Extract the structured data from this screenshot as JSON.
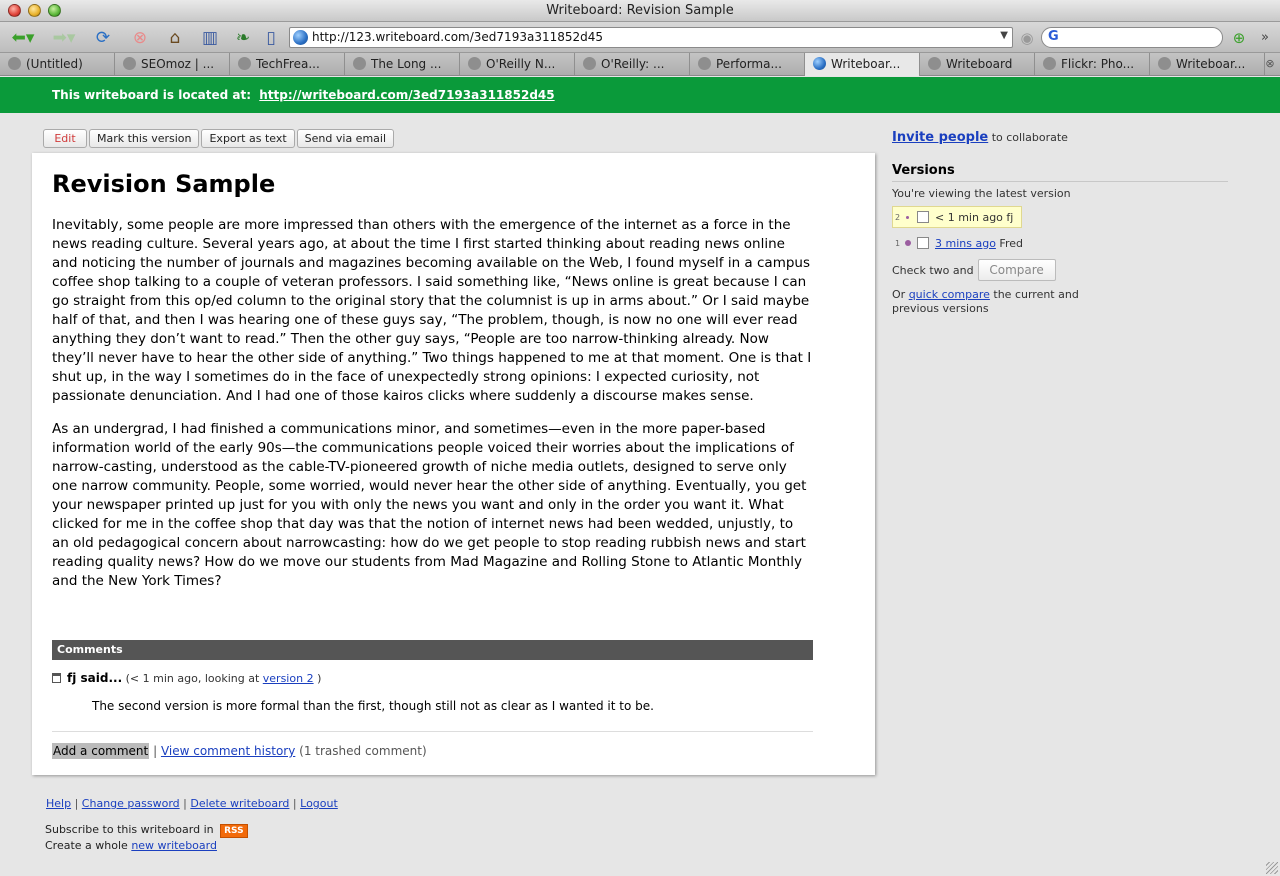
{
  "window": {
    "title": "Writeboard: Revision Sample"
  },
  "toolbar": {
    "url": "http://123.writeboard.com/3ed7193a311852d45",
    "search_engine_letter": "G"
  },
  "tabs": [
    {
      "label": "(Untitled)",
      "active": false
    },
    {
      "label": "SEOmoz | ...",
      "active": false
    },
    {
      "label": "TechFrea...",
      "active": false
    },
    {
      "label": "The Long ...",
      "active": false
    },
    {
      "label": "O'Reilly N...",
      "active": false
    },
    {
      "label": "O'Reilly: ...",
      "active": false
    },
    {
      "label": "Performa...",
      "active": false
    },
    {
      "label": "Writeboar...",
      "active": true
    },
    {
      "label": "Writeboard",
      "active": false
    },
    {
      "label": "Flickr: Pho...",
      "active": false
    },
    {
      "label": "Writeboar...",
      "active": false
    }
  ],
  "banner": {
    "prefix": "This writeboard is located at:",
    "link": "http://writeboard.com/3ed7193a311852d45"
  },
  "actions": {
    "edit": "Edit",
    "mark": "Mark this version",
    "export": "Export as text",
    "send": "Send via email"
  },
  "document": {
    "title": "Revision Sample",
    "paragraphs": [
      "Inevitably, some people are more impressed than others with the emergence of the internet as a force in the news reading culture. Several years ago, at about the time I first started thinking about reading news online and noticing the number of journals and magazines becoming available on the Web, I found myself in a campus coffee shop talking to a couple of veteran professors. I said something like, “News online is great because I can go straight from this op/ed column to the original story that the columnist is up in arms about.” Or I said maybe half of that, and then I was hearing one of these guys say, “The problem, though, is now no one will ever read anything they don’t want to read.” Then the other guy says, “People are too narrow-thinking already. Now they’ll never have to hear the other side of anything.” Two things happened to me at that moment. One is that I shut up, in the way I sometimes do in the face of unexpectedly strong opinions: I expected curiosity, not passionate denunciation. And I had one of those kairos clicks where suddenly a discourse makes sense.",
      "As an undergrad, I had finished a communications minor, and sometimes—even in the more paper-based information world of the early 90s—the communications people voiced their worries about the implications of narrow-casting, understood as the cable-TV-pioneered growth of niche media outlets, designed to serve only one narrow community. People, some worried, would never hear the other side of anything. Eventually, you get your newspaper printed up just for you with only the news you want and only in the order you want it. What clicked for me in the coffee shop that day was that the notion of internet news had been wedded, unjustly, to an old pedagogical concern about narrowcasting: how do we get people to stop reading rubbish news and start reading quality news? How do we move our students from Mad Magazine and Rolling Stone to Atlantic Monthly and the New York Times?"
    ]
  },
  "comments": {
    "header": "Comments",
    "items": [
      {
        "author": "fj said...",
        "meta_prefix": "(< 1 min ago, looking at",
        "version_link": "version 2",
        "meta_suffix": ")",
        "text": "The second version is more formal than the first, though still not as clear as I wanted it to be."
      }
    ],
    "add_comment": "Add a comment",
    "separator": "|",
    "history_link": "View comment history",
    "trashed": "(1 trashed comment)"
  },
  "sidebar": {
    "invite_link": "Invite people",
    "invite_suffix": "to collaborate",
    "versions_title": "Versions",
    "viewing": "You're viewing the latest version",
    "versions": [
      {
        "number": "2",
        "time": "< 1 min ago",
        "author": "fj",
        "current": true
      },
      {
        "number": "1",
        "time": "3 mins ago",
        "author": "Fred",
        "current": false
      }
    ],
    "check_two": "Check two and",
    "compare": "Compare",
    "quick_prefix": "Or",
    "quick_link": "quick compare",
    "quick_suffix": "the current and previous versions"
  },
  "footer": {
    "links": [
      "Help",
      "Change password",
      "Delete writeboard",
      "Logout"
    ],
    "separator": "|",
    "subscribe": "Subscribe to this writeboard in",
    "rss": "RSS",
    "create_prefix": "Create a whole",
    "create_link": "new writeboard"
  },
  "colors": {
    "banner": "#0a9a3a",
    "link": "#1a3fbf",
    "rss": "#f26a0a",
    "current_version_bg": "#ffffcc"
  },
  "icons": [
    "back-icon",
    "forward-icon",
    "reload-icon",
    "stop-icon",
    "home-icon",
    "bookmarks-icon",
    "leaf-icon",
    "page-icon",
    "globe-icon",
    "go-icon",
    "trash-icon"
  ]
}
